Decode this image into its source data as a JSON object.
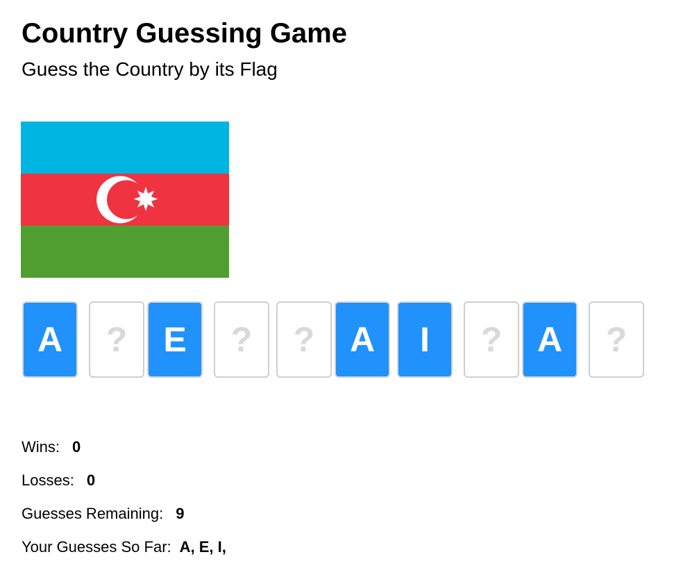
{
  "header": {
    "title": "Country Guessing Game",
    "subtitle": "Guess the Country by its Flag"
  },
  "flag": {
    "country": "Azerbaijan",
    "stripe_colors": [
      "#00b5e2",
      "#ef3340",
      "#509e2f"
    ],
    "emblem": "crescent-and-star"
  },
  "word": {
    "tiles": [
      {
        "letter": "A",
        "revealed": true
      },
      {
        "letter": "?",
        "revealed": false
      },
      {
        "letter": "E",
        "revealed": true
      },
      {
        "letter": "?",
        "revealed": false
      },
      {
        "letter": "?",
        "revealed": false
      },
      {
        "letter": "A",
        "revealed": true
      },
      {
        "letter": "I",
        "revealed": true
      },
      {
        "letter": "?",
        "revealed": false
      },
      {
        "letter": "A",
        "revealed": true
      },
      {
        "letter": "?",
        "revealed": false
      }
    ],
    "revealed_color": "#2191fb",
    "hidden_text_color": "#d9d9d9"
  },
  "stats": {
    "wins_label": "Wins:",
    "wins_value": "0",
    "losses_label": "Losses:",
    "losses_value": "0",
    "remaining_label": "Guesses Remaining:",
    "remaining_value": "9",
    "guesses_label": "Your Guesses So Far:",
    "guesses_value": "A, E, I,"
  }
}
